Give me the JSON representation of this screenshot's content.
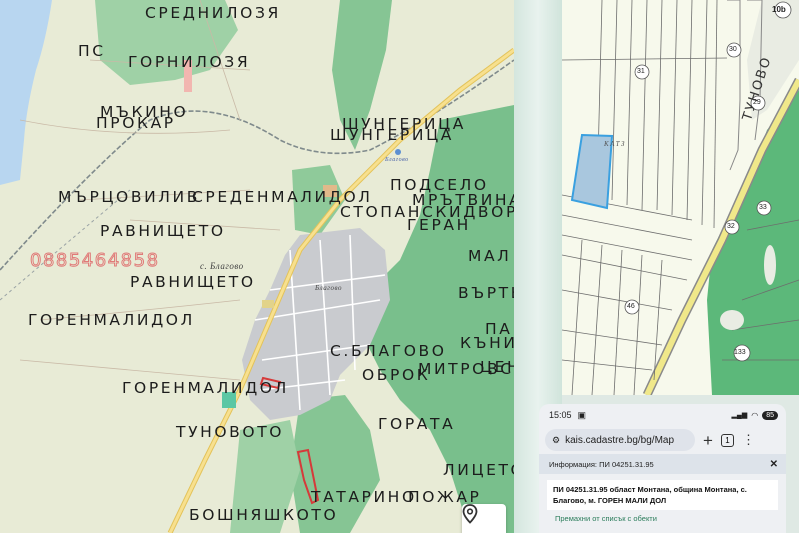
{
  "topo_map": {
    "labels": [
      "СРЕДНИЛОЗЯ",
      "ПС",
      "ГОРНИЛОЗЯ",
      "МЪКИНО",
      "ПРОКАР",
      "ШУНГЕРИЦА",
      "ШУНГЕРИЦА",
      "МЪРЦОВИЛИВ",
      "СРЕДЕНМАЛИДОЛ",
      "ПОДСЕЛО",
      "МРЪТВИНА",
      "СТОПАНСКИДВОР",
      "РАВНИЩЕТО",
      "ГЕРАН",
      "МАЛ",
      "РАВНИЩЕТО",
      "ВЪРТЬ",
      "ГОРЕНМАЛИДОЛ",
      "ПА",
      "КЪНИ",
      "С.БЛАГОВО",
      "МИТРОВСКИ",
      "ОБРОК",
      "ЦЕНИ",
      "ГОРЕНМАЛИДОЛ",
      "ТУНОВОТО",
      "ГОРАТА",
      "ЛИЦЕТО",
      "ТАТАРИНО",
      "ПОЖАР",
      "БОШНЯШКОТО"
    ],
    "small_labels": [
      "с. Благово",
      "Благово",
      "Благово"
    ],
    "watermark_phone": "0885464858",
    "location_button_icon": "map-pin-icon",
    "colors": {
      "forest": "#7cc08e",
      "field": "#e8ebd6",
      "village": "#c9cbcf",
      "road": "#f2d36b",
      "water": "#b8d6f0",
      "parcel_marker": "#d63a3a"
    }
  },
  "cadastre_map": {
    "road_label": "ТУНОВО",
    "area_label": "КАТЗ",
    "parcel_numbers": [
      "10b",
      "30",
      "31",
      "29",
      "33",
      "32",
      "46",
      "133"
    ],
    "colors": {
      "highlight_fill": "#a9c7de",
      "highlight_stroke": "#3aa0e0",
      "forest": "#5cb87a",
      "lines": "#6d6d6d"
    }
  },
  "phone_screenshot": {
    "time": "15:05",
    "status_icons": [
      "screenshot-icon",
      "signal-icon",
      "wifi-icon"
    ],
    "battery": "85",
    "url": "kais.cadastre.bg/bg/Map",
    "tab_count": "1",
    "info_title": "Информация: ПИ 04251.31.95",
    "info_text": "ПИ 04251.31.95 област Монтана, община Монтана, с. Благово, м. ГОРЕН МАЛИ ДОЛ",
    "link": "Премахни от списък с обекти"
  }
}
